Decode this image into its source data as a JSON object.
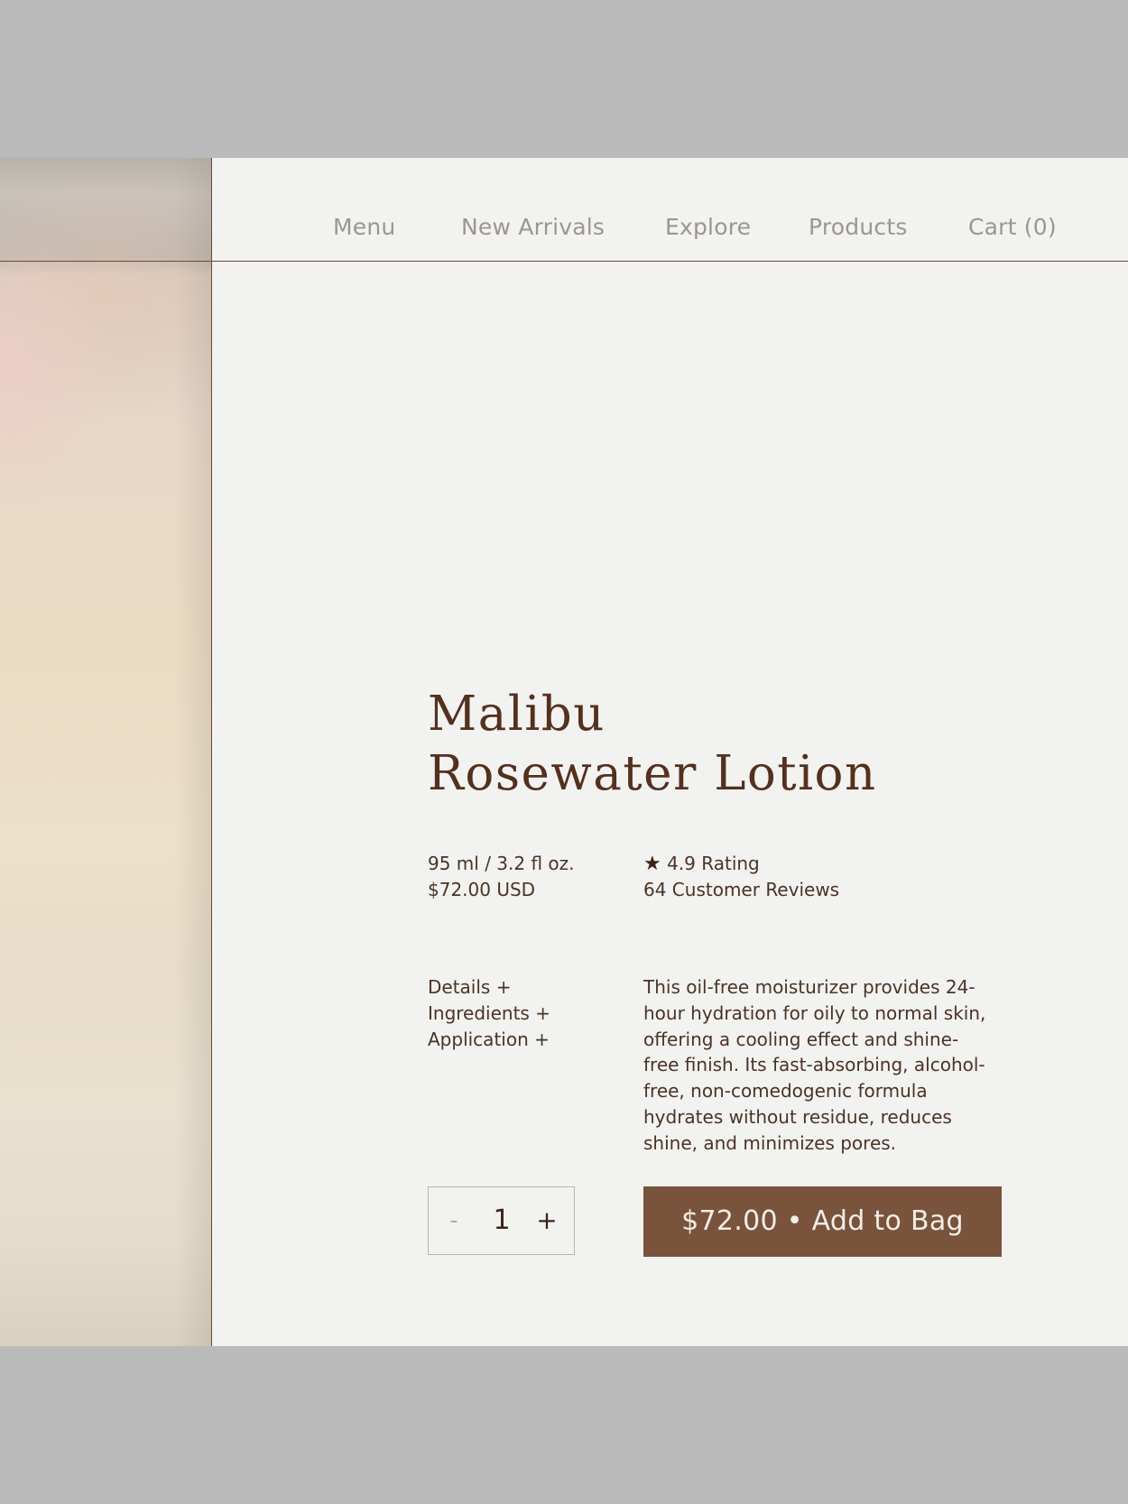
{
  "nav": {
    "items": [
      {
        "label": "Menu"
      },
      {
        "label": "New Arrivals"
      },
      {
        "label": "Explore"
      },
      {
        "label": "Products"
      },
      {
        "label": "Cart (0)"
      }
    ]
  },
  "product": {
    "title_line1": "Malibu",
    "title_line2": "Rosewater Lotion",
    "size": "95 ml / 3.2 fl oz.",
    "price": "$72.00 USD",
    "rating": "4.9 Rating",
    "rating_icon": "star-icon",
    "reviews": "64 Customer Reviews",
    "description": "This oil-free moisturizer provides 24-hour hydration for oily to normal skin, offering a cooling effect and shine-free finish. Its fast-absorbing, alcohol-free, non-comedogenic formula hydrates without residue, reduces shine, and minimizes pores."
  },
  "accordion": {
    "items": [
      {
        "label": "Details +"
      },
      {
        "label": "Ingredients +"
      },
      {
        "label": "Application +"
      }
    ]
  },
  "purchase": {
    "minus": "-",
    "quantity": "1",
    "plus": "+",
    "add_button": "$72.00 • Add to Bag"
  },
  "colors": {
    "page_background": "#bababa",
    "frame_background": "#f2f2f1",
    "accent": "#7a533c",
    "text_dark": "#54301e",
    "nav_text": "#9c968f"
  }
}
